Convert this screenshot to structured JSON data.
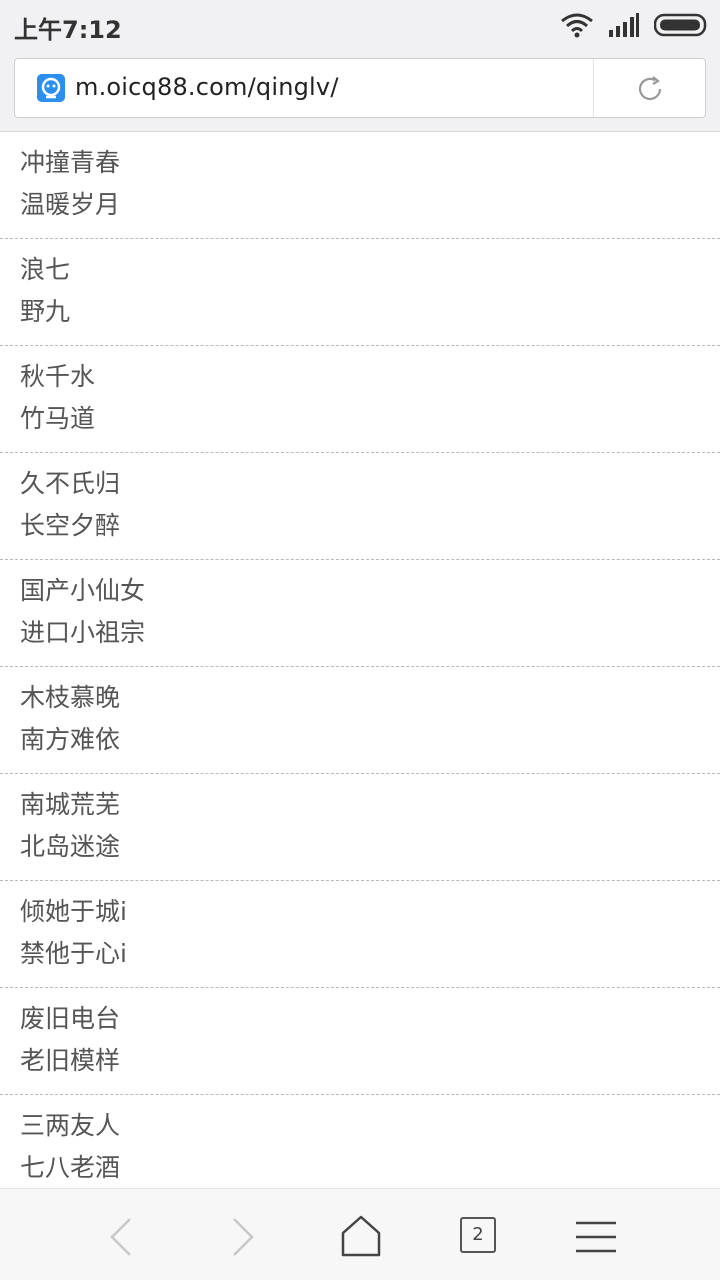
{
  "status": {
    "time": "上午7:12"
  },
  "browser": {
    "url": "m.oicq88.com/qinglv/",
    "tab_count": "2"
  },
  "list": [
    {
      "line1": "冲撞青春",
      "line2": "温暖岁月"
    },
    {
      "line1": "浪七",
      "line2": "野九"
    },
    {
      "line1": "秋千水",
      "line2": "竹马道"
    },
    {
      "line1": "久不氏归",
      "line2": "长空夕醉"
    },
    {
      "line1": "国产小仙女",
      "line2": "进口小祖宗"
    },
    {
      "line1": "木枝慕晚",
      "line2": "南方难依"
    },
    {
      "line1": "南城荒芜",
      "line2": "北岛迷途"
    },
    {
      "line1": "倾她于城i",
      "line2": "禁他于心i"
    },
    {
      "line1": "废旧电台",
      "line2": "老旧模样"
    },
    {
      "line1": "三两友人",
      "line2": "七八老酒"
    }
  ],
  "icons": {
    "site": "site-favicon-icon",
    "reload": "reload-icon",
    "back": "back-arrow-icon",
    "forward": "forward-arrow-icon",
    "home": "home-icon",
    "menu": "menu-icon"
  }
}
